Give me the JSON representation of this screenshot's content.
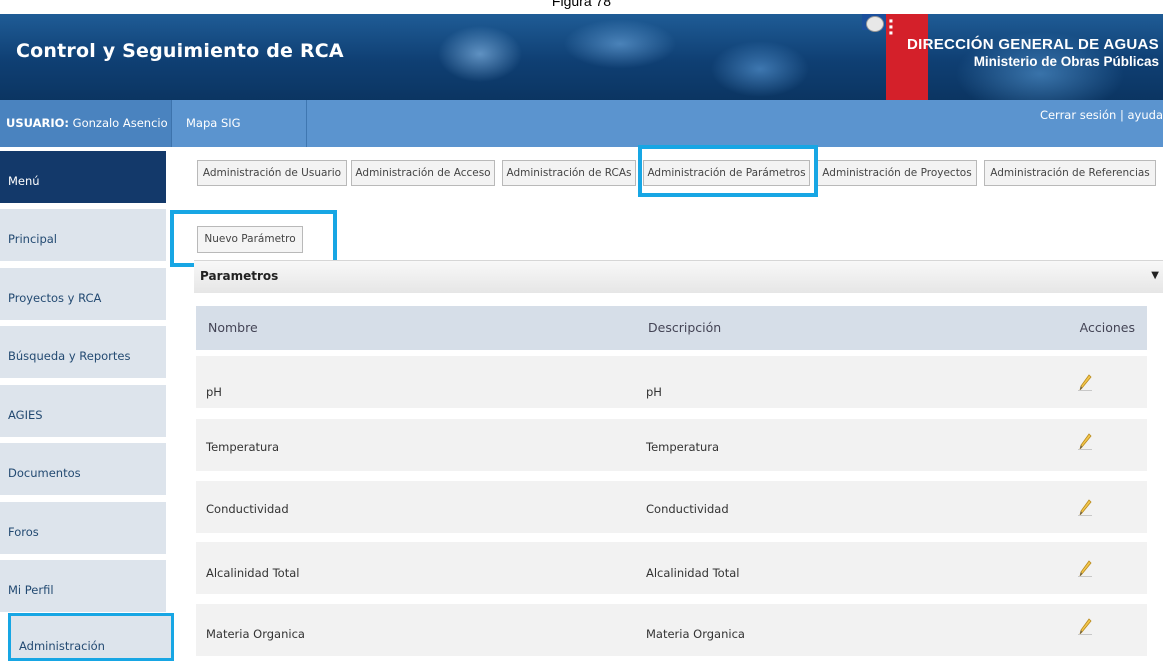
{
  "caption": "Figura 78",
  "header": {
    "title": "Control y Seguimiento de RCA",
    "org_line1": "DIRECCIÓN GENERAL DE AGUAS",
    "org_line2": "Ministerio de Obras Públicas"
  },
  "topbar": {
    "user_label": "USUARIO:",
    "user_name": "Gonzalo Asencio",
    "tab_mapa": "Mapa SIG",
    "logout": "Cerrar sesión",
    "separator": "|",
    "help": "ayuda"
  },
  "sidebar": {
    "items": [
      {
        "label": "Menú"
      },
      {
        "label": "Principal"
      },
      {
        "label": "Proyectos y RCA"
      },
      {
        "label": "Búsqueda y Reportes"
      },
      {
        "label": "AGIES"
      },
      {
        "label": "Documentos"
      },
      {
        "label": "Foros"
      },
      {
        "label": "Mi Perfil"
      },
      {
        "label": "Administración"
      }
    ]
  },
  "tabs": [
    {
      "label": "Administración de Usuario"
    },
    {
      "label": "Administración de Acceso"
    },
    {
      "label": "Administración de RCAs"
    },
    {
      "label": "Administración de Parámetros"
    },
    {
      "label": "Administración de Proyectos"
    },
    {
      "label": "Administración de Referencias"
    }
  ],
  "new_button": "Nuevo Parámetro",
  "section": {
    "title": "Parametros",
    "caret": "▼"
  },
  "table": {
    "columns": [
      "Nombre",
      "Descripción",
      "Acciones"
    ],
    "rows": [
      {
        "nombre": "pH",
        "descripcion": "pH"
      },
      {
        "nombre": "Temperatura",
        "descripcion": "Temperatura"
      },
      {
        "nombre": "Conductividad",
        "descripcion": "Conductividad"
      },
      {
        "nombre": "Alcalinidad Total",
        "descripcion": "Alcalinidad Total"
      },
      {
        "nombre": "Materia Organica",
        "descripcion": "Materia Organica"
      }
    ],
    "action_icon": "edit-pencil-icon"
  },
  "colors": {
    "highlight": "#17a6e4",
    "header_bg": "#0f3f73",
    "topbar_bg": "#5b94cf",
    "menu_bg": "#13396a"
  }
}
